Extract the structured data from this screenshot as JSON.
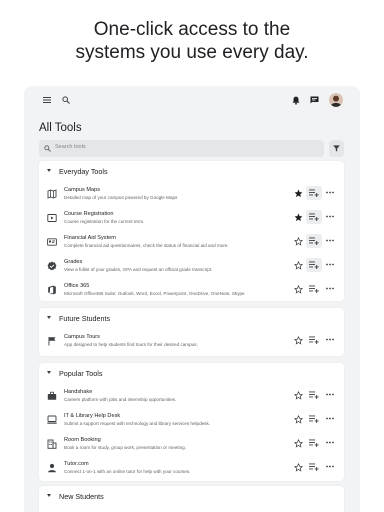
{
  "headline": {
    "line1": "One-click access to the",
    "line2": "systems you use every day."
  },
  "app": {
    "page_title": "All Tools",
    "search_placeholder": "Search tools",
    "icons": {
      "menu": "menu-icon",
      "search": "search-icon",
      "notifications": "bell-icon",
      "chat": "chat-icon",
      "filter": "filter-icon"
    }
  },
  "sections": [
    {
      "title": "Everyday Tools",
      "items": [
        {
          "name": "Campus Maps",
          "desc": "Detailed map of your campus powered by Google Maps",
          "icon": "map-icon",
          "starred": true,
          "queued": true
        },
        {
          "name": "Course Registration",
          "desc": "Course registration for the current term.",
          "icon": "video-icon",
          "starred": true,
          "queued": true
        },
        {
          "name": "Financial Aid System",
          "desc": "Complete financial aid questionnaires, check the status of financial aid and more.",
          "icon": "id-card-icon",
          "starred": false,
          "queued": true
        },
        {
          "name": "Grades",
          "desc": "View a fullist of your grades, GPA and request an official grade transcript.",
          "icon": "verified-icon",
          "starred": false,
          "queued": true
        },
        {
          "name": "Office 365",
          "desc": "Microsoft Office365 Suite: Outlook, Word, Excel, Powerpoint, OneDrive, OneNote, Skype",
          "icon": "office-icon",
          "starred": false,
          "queued": false
        }
      ]
    },
    {
      "title": "Future Students",
      "items": [
        {
          "name": "Campus Tours",
          "desc": "App designed to help students find tours for their desired campus.",
          "icon": "flag-icon",
          "starred": false,
          "queued": false
        }
      ]
    },
    {
      "title": "Popular Tools",
      "items": [
        {
          "name": "Handshake",
          "desc": "Careers platform with jobs and internship opportunities.",
          "icon": "briefcase-icon",
          "starred": false,
          "queued": false
        },
        {
          "name": "IT & Library Help Desk",
          "desc": "Submit a support request with technology and library services helpdesk.",
          "icon": "help-desk-icon",
          "starred": false,
          "queued": false
        },
        {
          "name": "Room Booking",
          "desc": "Book a room for study, group work, presentation or meeting.",
          "icon": "building-icon",
          "starred": false,
          "queued": false
        },
        {
          "name": "Tutor.com",
          "desc": "Connect 1-on-1 with an online tutor for help with your courses.",
          "icon": "person-icon",
          "starred": false,
          "queued": false
        }
      ]
    },
    {
      "title": "New Students",
      "items": []
    }
  ],
  "colors": {
    "panel_bg": "#f1f3f4",
    "text": "#202124",
    "muted": "#5f6368",
    "icon": "#3c4043"
  }
}
